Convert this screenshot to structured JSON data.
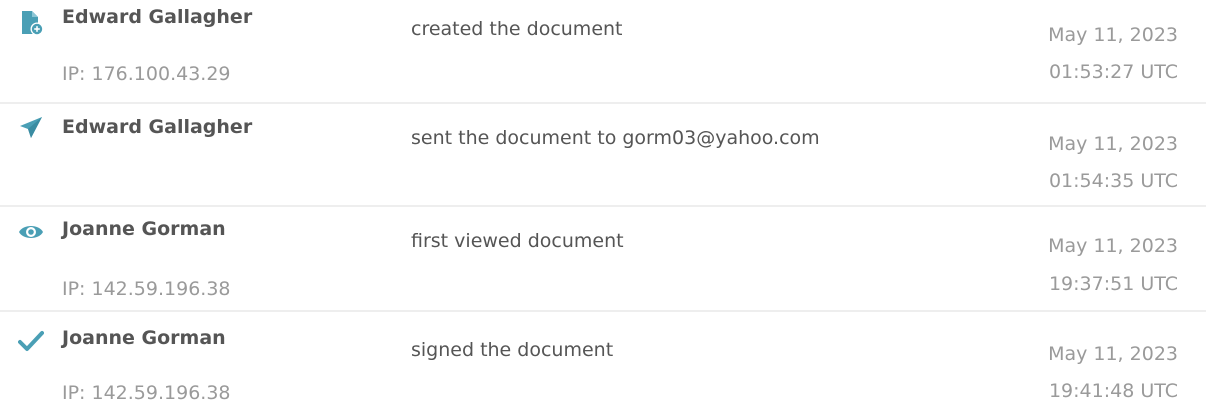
{
  "colors": {
    "icon_accent": "#4a9fb5",
    "actor_text": "#555555",
    "muted_text": "#9a9a9a",
    "divider": "#eeeeee"
  },
  "events": [
    {
      "icon": "document-add-icon",
      "actor": "Edward Gallagher",
      "ip": "IP: 176.100.43.29",
      "action": "created the document",
      "date": "May 11, 2023",
      "time": "01:53:27 UTC"
    },
    {
      "icon": "paper-plane-icon",
      "actor": "Edward Gallagher",
      "ip": "",
      "action": "sent the document to gorm03@yahoo.com",
      "date": "May 11, 2023",
      "time": "01:54:35 UTC"
    },
    {
      "icon": "eye-icon",
      "actor": "Joanne Gorman",
      "ip": "IP: 142.59.196.38",
      "action": "first viewed document",
      "date": "May 11, 2023",
      "time": "19:37:51 UTC"
    },
    {
      "icon": "checkmark-icon",
      "actor": "Joanne Gorman",
      "ip": "IP: 142.59.196.38",
      "action": "signed the document",
      "date": "May 11, 2023",
      "time": "19:41:48 UTC"
    }
  ]
}
